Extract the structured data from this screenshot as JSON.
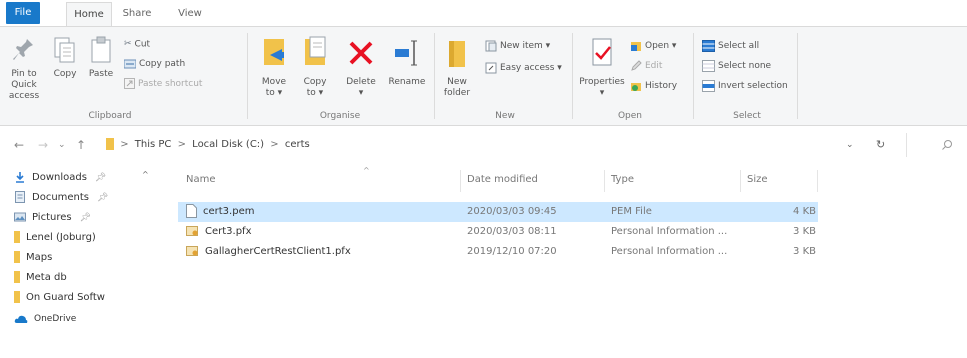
{
  "ribbon_tabs": {
    "file": "File",
    "home": "Home",
    "share": "Share",
    "view": "View"
  },
  "clipboard": {
    "pin_label_1": "Pin to Quick",
    "pin_label_2": "access",
    "copy": "Copy",
    "paste": "Paste",
    "cut": "Cut",
    "copy_path": "Copy path",
    "paste_shortcut": "Paste shortcut",
    "group": "Clipboard"
  },
  "organise": {
    "move_1": "Move",
    "move_2": "to ▾",
    "copy_1": "Copy",
    "copy_2": "to ▾",
    "delete": "Delete",
    "delete_arrow": "▾",
    "rename": "Rename",
    "group": "Organise"
  },
  "new": {
    "new_folder_1": "New",
    "new_folder_2": "folder",
    "new_item": "New item ▾",
    "easy_access": "Easy access ▾",
    "group": "New"
  },
  "open": {
    "properties": "Properties",
    "properties_arrow": "▾",
    "open": "Open ▾",
    "edit": "Edit",
    "history": "History",
    "group": "Open"
  },
  "select": {
    "select_all": "Select all",
    "select_none": "Select none",
    "invert": "Invert selection",
    "group": "Select"
  },
  "address": {
    "this_pc": "This PC",
    "local_disk": "Local Disk (C:)",
    "folder": "certs",
    "sep": ">"
  },
  "nav_pane": [
    {
      "label": "Downloads",
      "icon": "download-icon",
      "pinned": true
    },
    {
      "label": "Documents",
      "icon": "documents-icon",
      "pinned": true
    },
    {
      "label": "Pictures",
      "icon": "pictures-icon",
      "pinned": true
    },
    {
      "label": "Lenel (Joburg)",
      "icon": "folder-icon",
      "pinned": false
    },
    {
      "label": "Maps",
      "icon": "folder-icon",
      "pinned": false
    },
    {
      "label": "Meta db",
      "icon": "folder-icon",
      "pinned": false
    },
    {
      "label": "On Guard Softw",
      "icon": "folder-icon",
      "pinned": false
    },
    {
      "label": "OneDrive",
      "icon": "onedrive-icon",
      "pinned": false
    }
  ],
  "columns": {
    "name": "Name",
    "date": "Date modified",
    "type": "Type",
    "size": "Size"
  },
  "files": [
    {
      "name": "cert3.pem",
      "date": "2020/03/03 09:45",
      "type": "PEM File",
      "size": "4 KB",
      "icon": "blank-file-icon",
      "selected": true
    },
    {
      "name": "Cert3.pfx",
      "date": "2020/03/03 08:11",
      "type": "Personal Information ...",
      "size": "3 KB",
      "icon": "certificate-file-icon",
      "selected": false
    },
    {
      "name": "GallagherCertRestClient1.pfx",
      "date": "2019/12/10 07:20",
      "type": "Personal Information ...",
      "size": "3 KB",
      "icon": "certificate-file-icon",
      "selected": false
    }
  ],
  "colors": {
    "accent": "#1979ca",
    "selection": "#cde8ff",
    "delete_red": "#e81123",
    "folder_yellow": "#f1c24a"
  }
}
